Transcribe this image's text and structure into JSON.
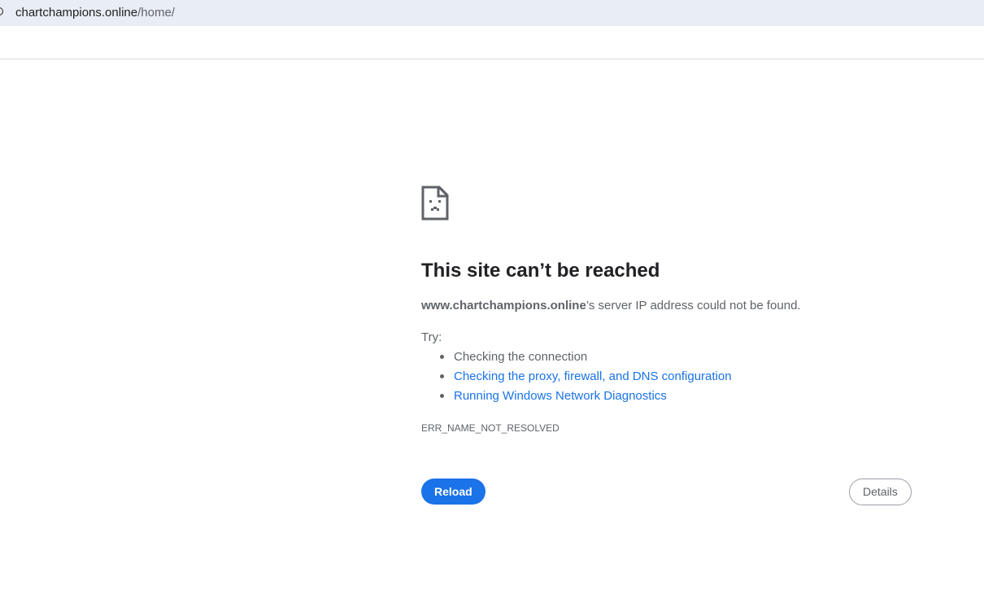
{
  "address_bar": {
    "host": "chartchampions.online",
    "path": "/home/"
  },
  "error_page": {
    "icon": "sad-page-icon",
    "title": "This site can’t be reached",
    "summary_domain": "www.chartchampions.online",
    "summary_rest": "’s server IP address could not be found.",
    "try_label": "Try:",
    "suggestions": [
      {
        "text": "Checking the connection",
        "is_link": false
      },
      {
        "text": "Checking the proxy, firewall, and DNS configuration",
        "is_link": true
      },
      {
        "text": "Running Windows Network Diagnostics",
        "is_link": true
      }
    ],
    "error_code": "ERR_NAME_NOT_RESOLVED",
    "reload_label": "Reload",
    "details_label": "Details"
  },
  "colors": {
    "accent": "#1a73e8",
    "text_secondary": "#5f6368",
    "addressbar_bg": "#e9eef6"
  }
}
